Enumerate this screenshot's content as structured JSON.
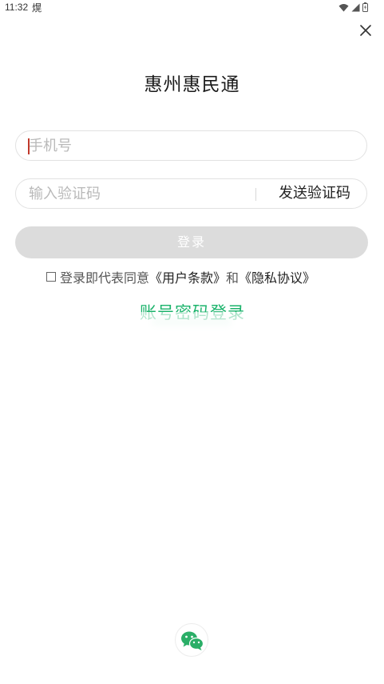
{
  "status_bar": {
    "time": "11:32",
    "extra": "熀",
    "icons": [
      "wifi-icon",
      "signal-icon",
      "battery-icon"
    ]
  },
  "header": {
    "title": "惠州惠民通",
    "close_icon": "close-icon"
  },
  "phone_field": {
    "placeholder": "手机号",
    "value": ""
  },
  "code_field": {
    "placeholder": "输入验证码",
    "value": "",
    "send_label": "发送验证码"
  },
  "login_button": {
    "label": "登录"
  },
  "agreement": {
    "prefix": "登录即代表同意",
    "terms": "《用户条款》",
    "conjunction": "和",
    "privacy": "《隐私协议》",
    "checked": false
  },
  "alt_login": {
    "label": "账号密码登录"
  },
  "social": {
    "wechat_icon": "wechat-icon"
  },
  "colors": {
    "accent_green": "#1bb36b",
    "button_disabled": "#dcdcdc",
    "border": "#e2e2e2"
  }
}
